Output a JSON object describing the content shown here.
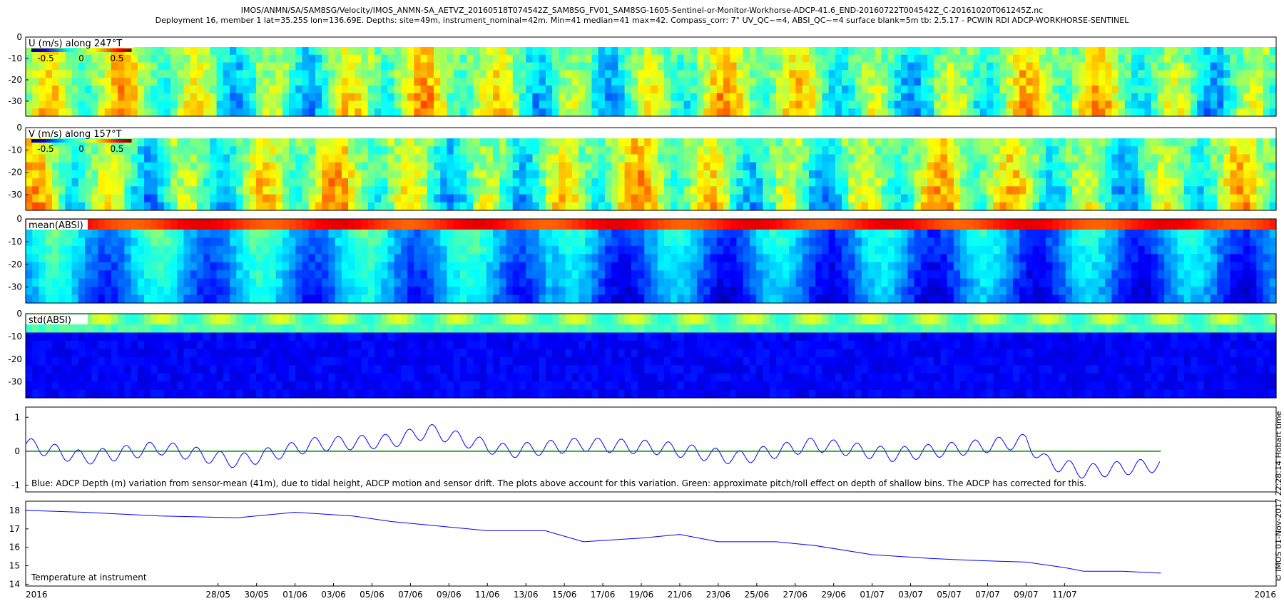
{
  "header": {
    "line1": "IMOS/ANMN/SA/SAM8SG/Velocity/IMOS_ANMN-SA_AETVZ_20160518T074542Z_SAM8SG_FV01_SAM8SG-1605-Sentinel-or-Monitor-Workhorse-ADCP-41.6_END-20160722T004542Z_C-20161020T061245Z.nc",
    "line2": "Deployment 16, member 1 lat=35.25S lon=136.69E. Depths: site=49m, instrument_nominal=42m. Min=41 median=41 max=42. Compass_corr: 7° UV_QC~=4, ABSI_QC~=4 surface blank=5m tb: 2.5.17 - PCWIN RDI ADCP-WORKHORSE-SENTINEL"
  },
  "side_label": "© IMOS 01-Nov-2017 22:28:14 Hobart time",
  "x_axis": {
    "start_label": "2016",
    "end_label": "2016",
    "ticks": [
      "28/05",
      "30/05",
      "01/06",
      "03/06",
      "05/06",
      "07/06",
      "09/06",
      "11/06",
      "13/06",
      "15/06",
      "17/06",
      "19/06",
      "21/06",
      "23/06",
      "25/06",
      "27/06",
      "29/06",
      "01/07",
      "03/07",
      "05/07",
      "07/07",
      "09/07",
      "11/07"
    ]
  },
  "colors": {
    "series_blue": "#0000ff",
    "series_green": "#008000",
    "axis": "#000000"
  },
  "chart_data": [
    {
      "type": "heatmap",
      "title": "U (m/s) along 247°T",
      "colorbar": {
        "ticks": [
          "-0.5",
          "0",
          "0.5"
        ],
        "range": [
          -0.7,
          0.7
        ]
      },
      "yticks": [
        "0",
        "-10",
        "-20",
        "-30"
      ],
      "ylim": [
        -37,
        0
      ]
    },
    {
      "type": "heatmap",
      "title": "V (m/s) along 157°T",
      "colorbar": {
        "ticks": [
          "-0.5",
          "0",
          "0.5"
        ],
        "range": [
          -0.7,
          0.7
        ]
      },
      "yticks": [
        "0",
        "-10",
        "-20",
        "-30"
      ],
      "ylim": [
        -37,
        0
      ]
    },
    {
      "type": "heatmap",
      "title": "mean(ABSI)",
      "yticks": [
        "0",
        "-10",
        "-20",
        "-30"
      ],
      "ylim": [
        -37,
        0
      ]
    },
    {
      "type": "heatmap",
      "title": "std(ABSI)",
      "yticks": [
        "0",
        "-10",
        "-20",
        "-30"
      ],
      "ylim": [
        -37,
        0
      ]
    },
    {
      "type": "line",
      "yticks": [
        "1",
        "0",
        "-1"
      ],
      "ylim": [
        -1.2,
        1.3
      ],
      "annotation": "Blue: ADCP Depth (m) variation from sensor-mean (41m), due to tidal height, ADCP motion and sensor drift. The plots above account for this variation. Green: approximate pitch/roll effect on depth of shallow bins. The ADCP has corrected for this.",
      "series": [
        {
          "color": "#0000ff"
        },
        {
          "color": "#008000"
        }
      ],
      "x": [
        "18/05",
        "21/05",
        "25/05",
        "29/05",
        "02/06",
        "06/06",
        "08/06",
        "12/06",
        "16/06",
        "20/06",
        "24/06",
        "28/06",
        "02/07",
        "06/07",
        "09/07",
        "10/07",
        "12/07",
        "14/07",
        "16/07"
      ],
      "values_blue": [
        0.2,
        -0.2,
        0.1,
        -0.3,
        0.2,
        0.3,
        0.6,
        0.0,
        0.2,
        0.1,
        -0.2,
        0.2,
        -0.1,
        0.1,
        0.3,
        -0.3,
        -0.6,
        -0.5,
        -0.4
      ],
      "values_green": [
        0.0,
        0.0,
        0.0,
        0.0,
        0.0,
        0.0,
        0.0,
        0.0,
        0.0,
        0.0,
        0.0,
        0.0,
        0.0,
        0.0,
        0.0,
        0.0,
        0.0,
        0.0,
        0.0
      ]
    },
    {
      "type": "line",
      "ylabel": "Temperature at instrument",
      "yticks": [
        "18",
        "17",
        "16",
        "15",
        "14"
      ],
      "ylim": [
        13.9,
        18.5
      ],
      "x": [
        "18/05",
        "21/05",
        "25/05",
        "29/05",
        "01/06",
        "04/06",
        "06/06",
        "08/06",
        "11/06",
        "14/06",
        "16/06",
        "19/06",
        "21/06",
        "23/06",
        "26/06",
        "28/06",
        "01/07",
        "04/07",
        "06/07",
        "09/07",
        "11/07",
        "12/07",
        "14/07",
        "16/07"
      ],
      "values": [
        18.0,
        17.9,
        17.7,
        17.6,
        17.9,
        17.7,
        17.4,
        17.2,
        16.9,
        16.9,
        16.3,
        16.5,
        16.7,
        16.3,
        16.3,
        16.1,
        15.6,
        15.4,
        15.3,
        15.2,
        14.9,
        14.7,
        14.7,
        14.6
      ],
      "series": [
        {
          "color": "#0000ff"
        }
      ]
    }
  ]
}
